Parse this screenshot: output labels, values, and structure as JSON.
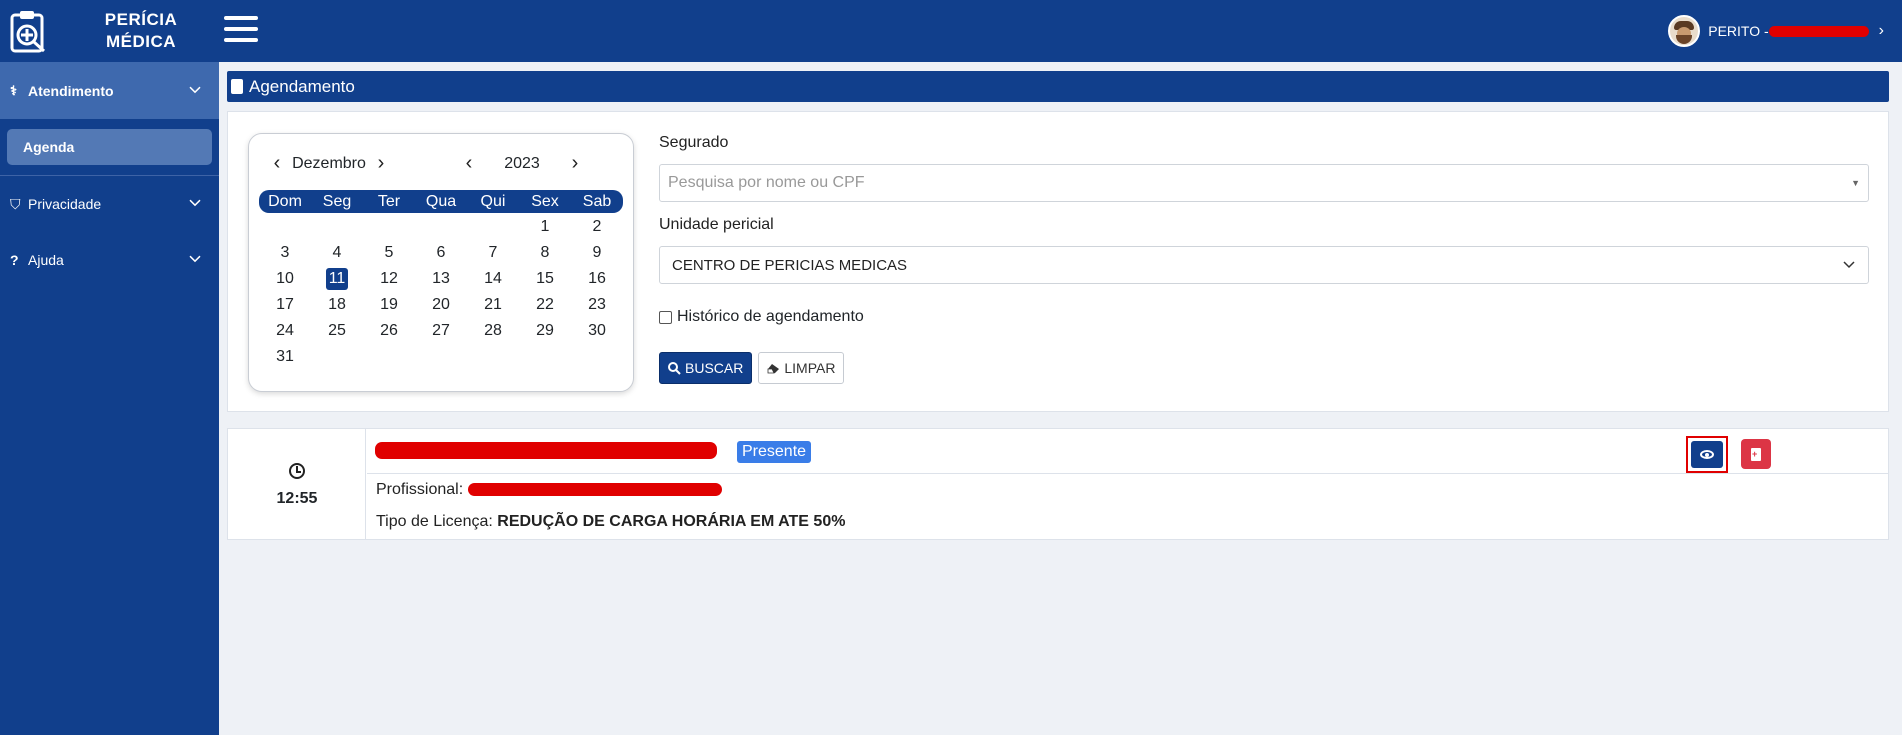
{
  "brand": {
    "line1": "PERÍCIA",
    "line2": "MÉDICA"
  },
  "user": {
    "label": "PERITO - "
  },
  "sidebar": {
    "atendimento": "Atendimento",
    "agenda": "Agenda",
    "privacidade": "Privacidade",
    "ajuda": "Ajuda"
  },
  "section_title": "Agendamento",
  "calendar": {
    "month": "Dezembro",
    "year": "2023",
    "weekdays": [
      "Dom",
      "Seg",
      "Ter",
      "Qua",
      "Qui",
      "Sex",
      "Sab"
    ],
    "selected_day": "11"
  },
  "form": {
    "segurado_label": "Segurado",
    "segurado_placeholder": "Pesquisa por nome ou CPF",
    "unidade_label": "Unidade pericial",
    "unidade_value": "CENTRO DE PERICIAS MEDICAS",
    "historico_label": "Histórico de agendamento",
    "buscar": "BUSCAR",
    "limpar": "LIMPAR"
  },
  "appointment": {
    "time": "12:55",
    "status": "Presente",
    "profissional_label": "Profissional:",
    "tipo_label": "Tipo de Licença:",
    "tipo_value": "REDUÇÃO DE CARGA HORÁRIA EM ATE 50%"
  },
  "colors": {
    "primary": "#113f8c",
    "accent": "#3a7de8",
    "danger": "#dc3545"
  },
  "icons": [
    "clipboard-plus-icon",
    "menu-icon",
    "stethoscope-icon",
    "shield-icon",
    "question-icon",
    "chevron-down-icon",
    "id-card-icon",
    "search-icon",
    "eraser-icon",
    "clock-icon",
    "eye-icon",
    "file-pdf-icon"
  ]
}
